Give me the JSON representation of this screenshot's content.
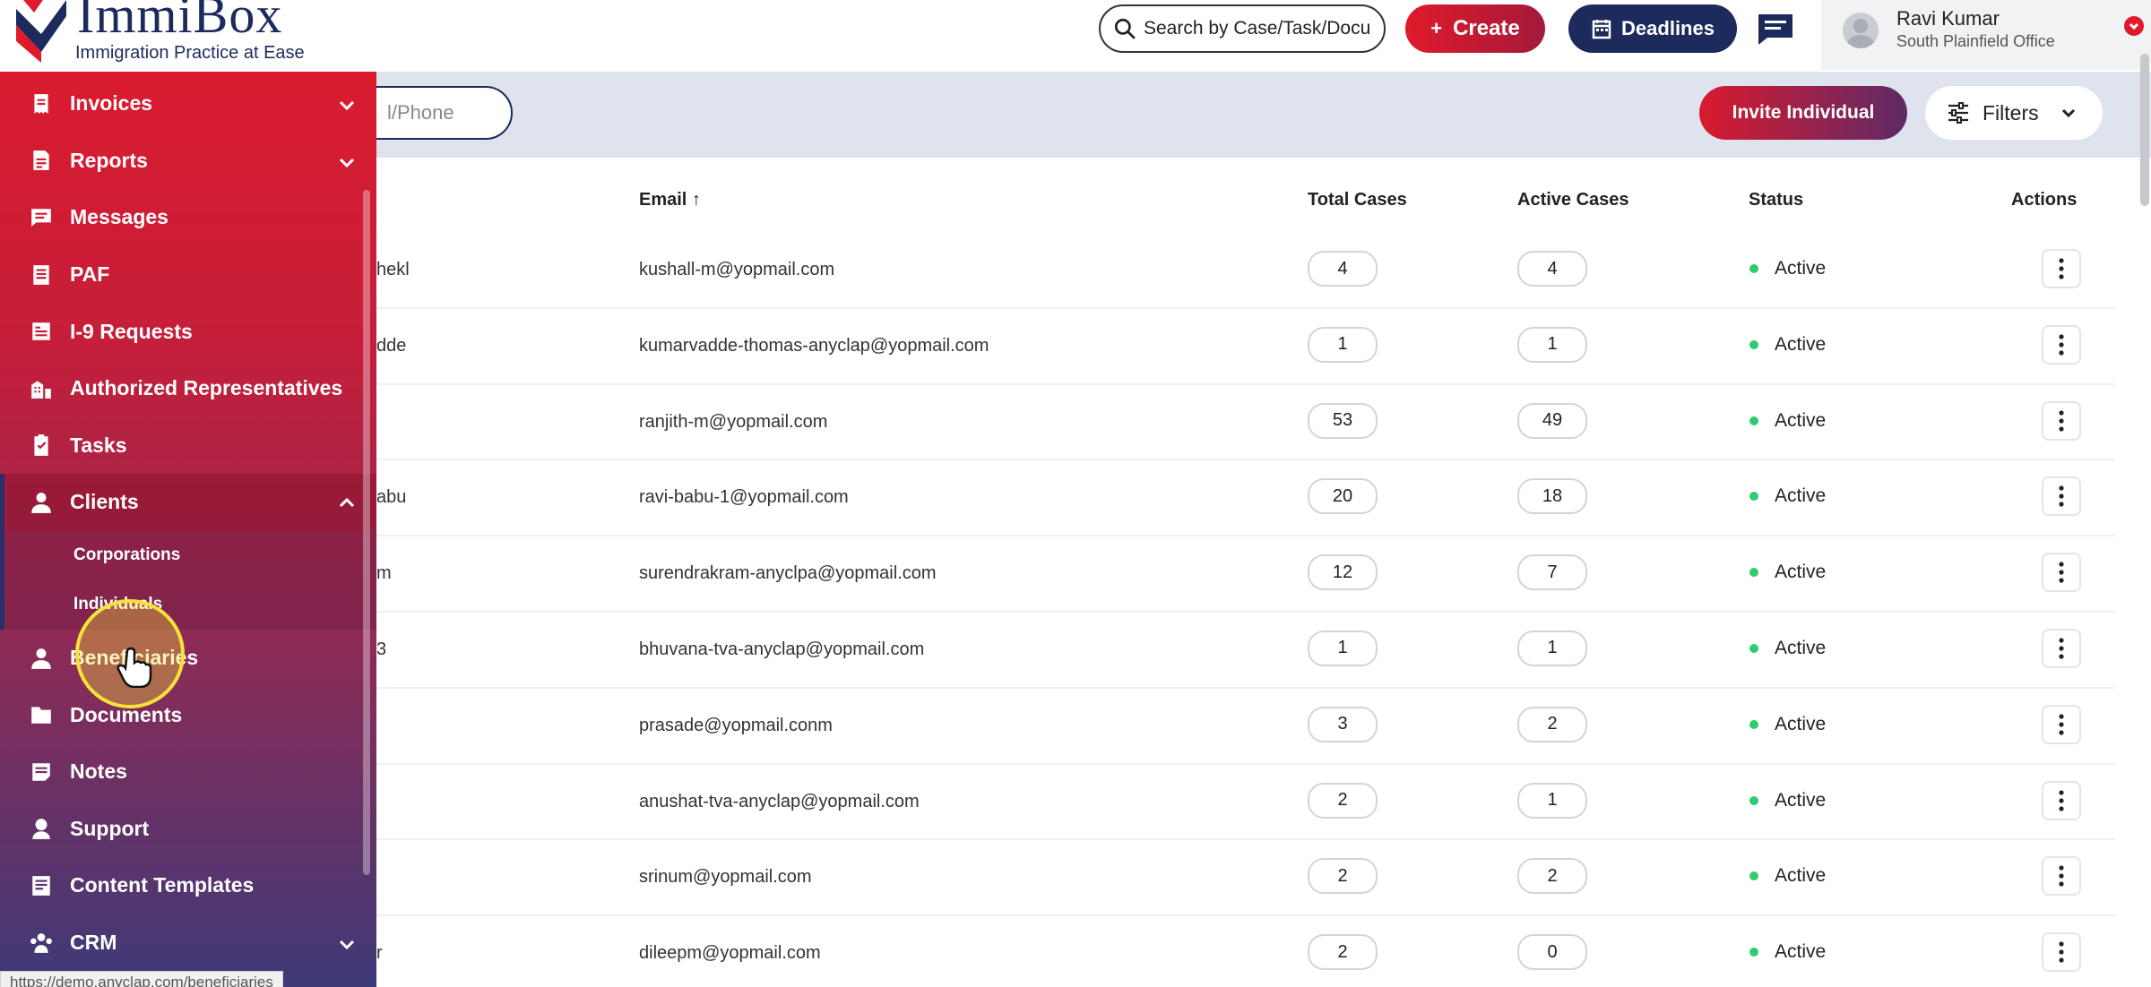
{
  "brand": {
    "name": "ImmiBox",
    "tagline": "Immigration Practice at Ease"
  },
  "sidebar": {
    "items": [
      {
        "label": "Invoices",
        "icon": "invoice-icon",
        "has_chevron": true
      },
      {
        "label": "Reports",
        "icon": "report-icon",
        "has_chevron": true
      },
      {
        "label": "Messages",
        "icon": "message-icon",
        "has_chevron": false
      },
      {
        "label": "PAF",
        "icon": "paf-icon",
        "has_chevron": false
      },
      {
        "label": "I-9 Requests",
        "icon": "i9-icon",
        "has_chevron": false
      },
      {
        "label": "Authorized Representatives",
        "icon": "representative-icon",
        "has_chevron": false
      },
      {
        "label": "Tasks",
        "icon": "task-icon",
        "has_chevron": false
      },
      {
        "label": "Clients",
        "icon": "client-icon",
        "has_chevron": true,
        "expanded": true
      },
      {
        "label": "Beneficiaries",
        "icon": "beneficiary-icon",
        "has_chevron": false
      },
      {
        "label": "Documents",
        "icon": "folder-icon",
        "has_chevron": false
      },
      {
        "label": "Notes",
        "icon": "note-icon",
        "has_chevron": false
      },
      {
        "label": "Support",
        "icon": "support-icon",
        "has_chevron": false
      },
      {
        "label": "Content Templates",
        "icon": "template-icon",
        "has_chevron": false
      },
      {
        "label": "CRM",
        "icon": "crm-icon",
        "has_chevron": true
      }
    ],
    "clients_submenu": [
      "Corporations",
      "Individuals"
    ]
  },
  "status_url": "https://demo.anyclap.com/beneficiaries",
  "topbar": {
    "search_placeholder": "Search by Case/Task/Docu",
    "create_label": "Create",
    "deadlines_label": "Deadlines",
    "user_name": "Ravi Kumar",
    "user_office": "South Plainfield Office"
  },
  "filters": {
    "search_placeholder": "l/Phone",
    "invite_label": "Invite Individual",
    "filters_label": "Filters"
  },
  "table": {
    "headers": {
      "email": "Email ↑",
      "total_cases": "Total Cases",
      "active_cases": "Active Cases",
      "status": "Status",
      "actions": "Actions"
    },
    "rows": [
      {
        "name": "hekl",
        "email": "kushall-m@yopmail.com",
        "total": "4",
        "active": "4",
        "status": "Active"
      },
      {
        "name": "dde",
        "email": "kumarvadde-thomas-anyclap@yopmail.com",
        "total": "1",
        "active": "1",
        "status": "Active"
      },
      {
        "name": "",
        "email": "ranjith-m@yopmail.com",
        "total": "53",
        "active": "49",
        "status": "Active"
      },
      {
        "name": "abu",
        "email": "ravi-babu-1@yopmail.com",
        "total": "20",
        "active": "18",
        "status": "Active"
      },
      {
        "name": "m",
        "email": "surendrakram-anyclpa@yopmail.com",
        "total": "12",
        "active": "7",
        "status": "Active"
      },
      {
        "name": "3",
        "email": "bhuvana-tva-anyclap@yopmail.com",
        "total": "1",
        "active": "1",
        "status": "Active"
      },
      {
        "name": "",
        "email": "prasade@yopmail.conm",
        "total": "3",
        "active": "2",
        "status": "Active"
      },
      {
        "name": "",
        "email": "anushat-tva-anyclap@yopmail.com",
        "total": "2",
        "active": "1",
        "status": "Active"
      },
      {
        "name": "",
        "email": "srinum@yopmail.com",
        "total": "2",
        "active": "2",
        "status": "Active"
      },
      {
        "name": "r",
        "email": "dileepm@yopmail.com",
        "total": "2",
        "active": "0",
        "status": "Active"
      }
    ]
  },
  "colors": {
    "brand_red": "#e01a2b",
    "brand_navy": "#1c2a5c",
    "status_active": "#2ecc71"
  }
}
